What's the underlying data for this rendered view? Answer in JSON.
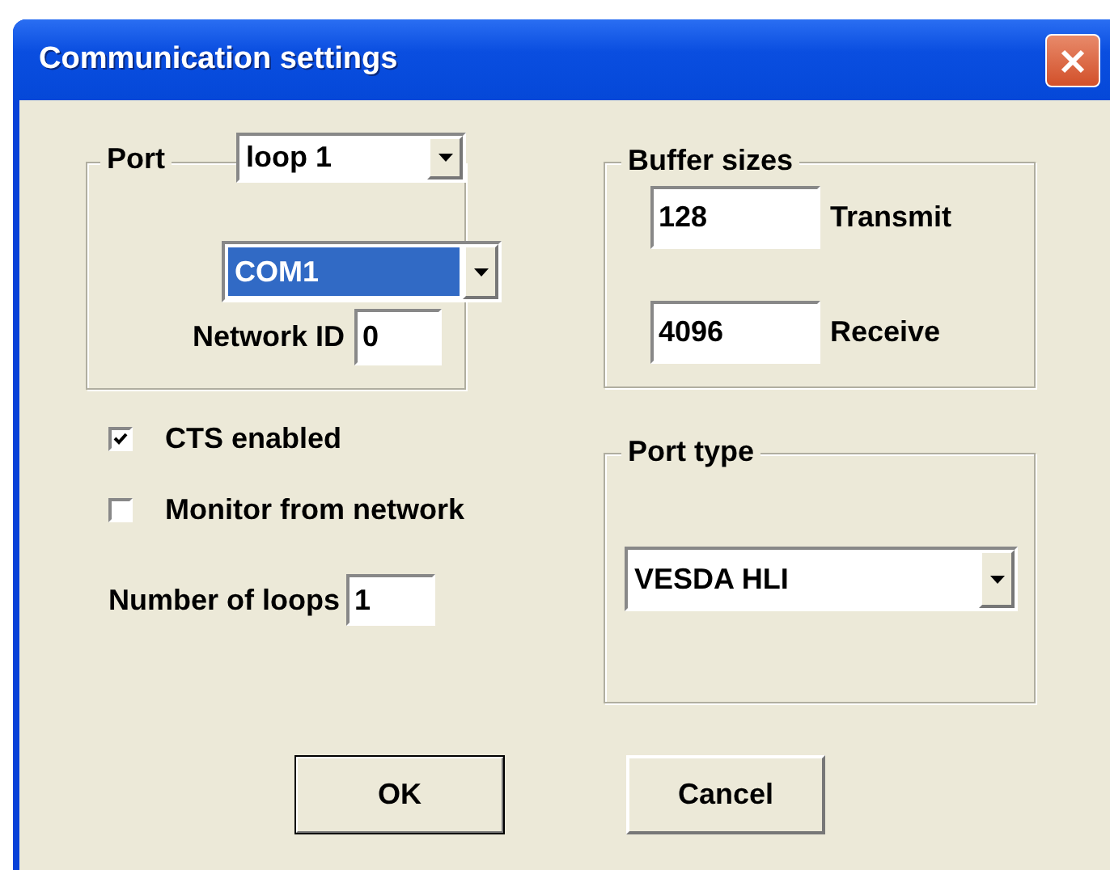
{
  "window": {
    "title": "Communication settings"
  },
  "port": {
    "label": "Port",
    "loop": "loop 1",
    "com_port": {
      "value": "COM1",
      "highlighted": true
    },
    "network_id_label": "Network ID",
    "network_id": "0"
  },
  "buffer_sizes": {
    "label": "Buffer sizes",
    "fields": [
      {
        "value": "128",
        "label": "Transmit"
      },
      {
        "value": "4096",
        "label": "Receive"
      }
    ]
  },
  "options": [
    {
      "label": "CTS enabled",
      "checked": true
    },
    {
      "label": "Monitor from network",
      "checked": false
    }
  ],
  "loops": {
    "label": "Number of loops",
    "value": "1"
  },
  "port_type": {
    "label": "Port type",
    "value": "VESDA HLI"
  },
  "buttons": [
    {
      "label": "OK",
      "default": true
    },
    {
      "label": "Cancel",
      "default": false
    }
  ]
}
